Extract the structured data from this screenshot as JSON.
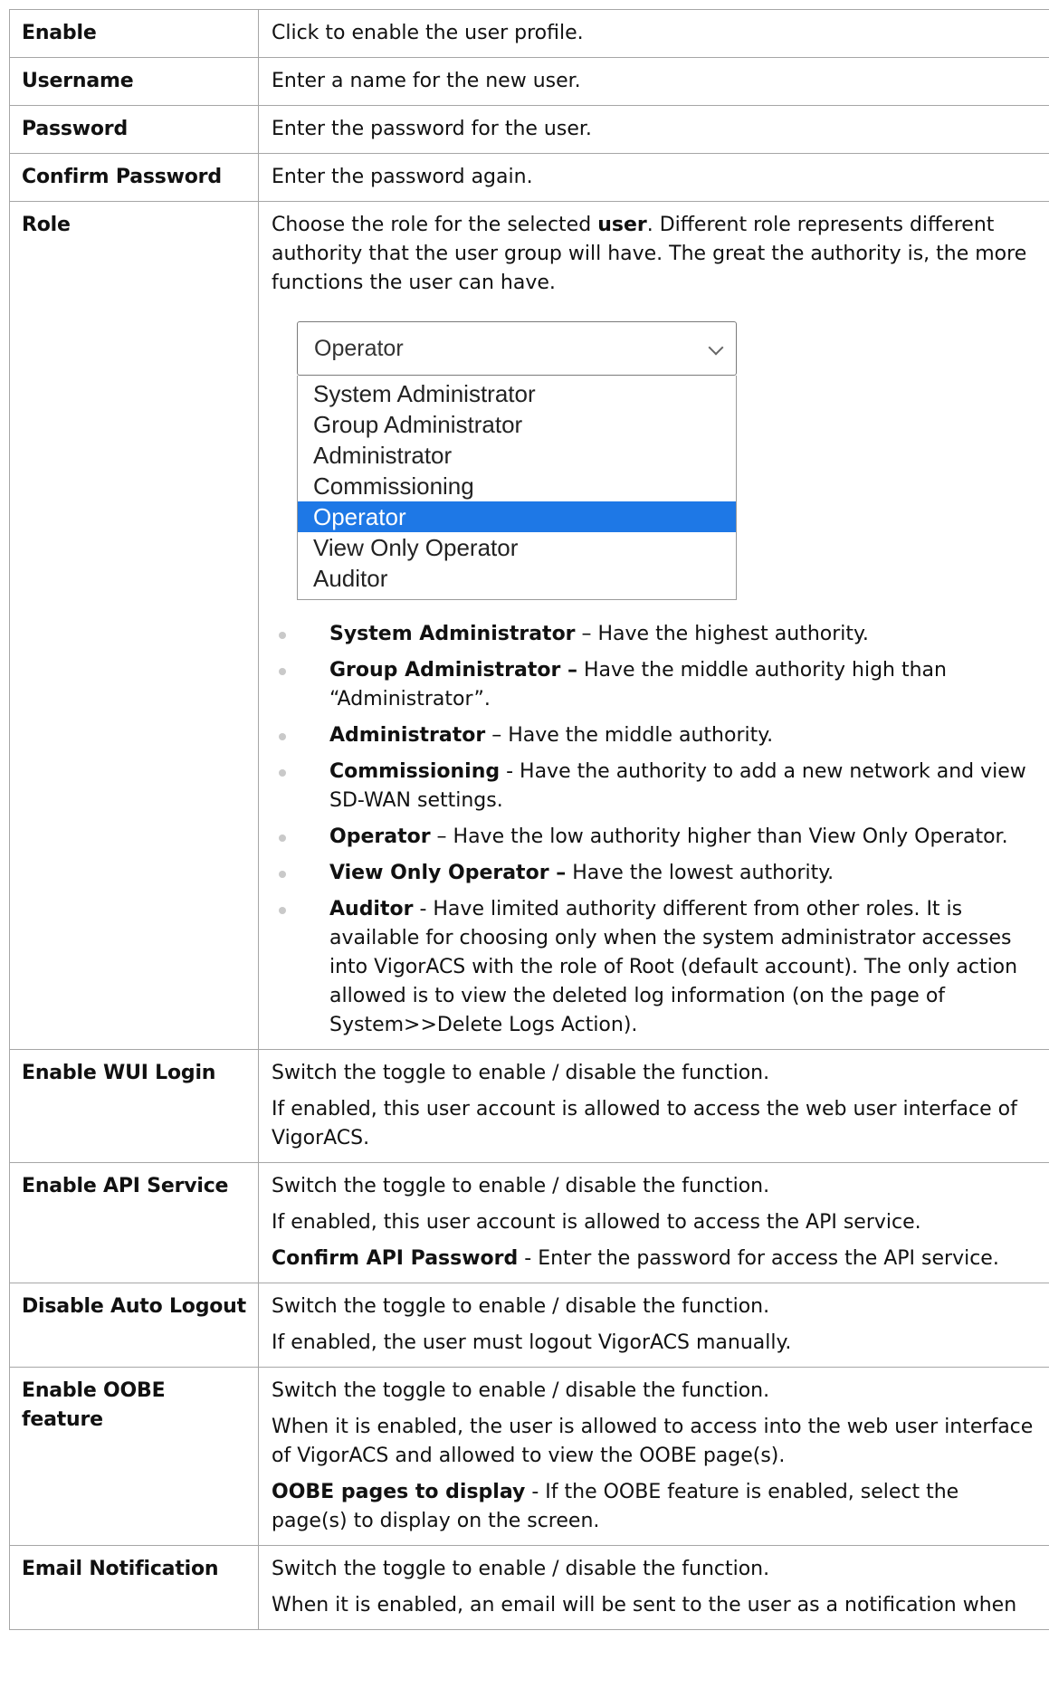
{
  "rows": [
    {
      "label": "Enable",
      "desc": [
        "Click to enable the user profile."
      ]
    },
    {
      "label": "Username",
      "desc": [
        "Enter a name for the new user."
      ]
    },
    {
      "label": "Password",
      "desc": [
        "Enter the password for the user."
      ]
    },
    {
      "label": "Confirm Password",
      "desc": [
        "Enter the password again."
      ]
    },
    {
      "label": "Role",
      "intro_before": "Choose the role for the selected ",
      "intro_bold": "user",
      "intro_after": ". Different role represents different authority that the user group will have. The great the authority is, the more functions the user can have.",
      "dropdown": {
        "selected": "Operator",
        "options": [
          "System Administrator",
          "Group Administrator",
          "Administrator",
          "Commissioning",
          "Operator",
          "View Only Operator",
          "Auditor"
        ],
        "highlighted_index": 4,
        "highlight_color": "#1e78e6"
      },
      "bullets": [
        {
          "term": "System Administrator",
          "text": " – Have the highest authority."
        },
        {
          "term": "Group Administrator –",
          "text": " Have the middle authority high than “Administrator”."
        },
        {
          "term": "Administrator",
          "text": " – Have the middle authority."
        },
        {
          "term": "Commissioning",
          "text": " - Have the authority to add a new network and view SD-WAN settings."
        },
        {
          "term": "Operator",
          "text": " – Have the low authority higher than View Only Operator."
        },
        {
          "term": "View Only Operator –",
          "text": " Have the lowest authority."
        },
        {
          "term": "Auditor",
          "text": " - Have limited authority different from other roles. It is available for choosing only when the system administrator accesses into VigorACS with the role of Root (default account). The only action allowed is to view the deleted log information (on the page of System>>Delete Logs Action)."
        }
      ]
    },
    {
      "label": "Enable WUI Login",
      "desc": [
        "Switch the toggle to enable / disable the function.",
        "If enabled, this user account is allowed to access the web user interface of VigorACS."
      ]
    },
    {
      "label": "Enable API Service",
      "desc": [
        "Switch the toggle to enable / disable the function.",
        "If enabled, this user account is allowed to access the API service."
      ],
      "extra": {
        "term": "Confirm API Password",
        "text": " - Enter the password for access the API service."
      }
    },
    {
      "label": "Disable Auto Logout",
      "desc": [
        "Switch the toggle to enable / disable the function.",
        "If enabled, the user must logout VigorACS manually."
      ]
    },
    {
      "label": "Enable OOBE feature",
      "desc": [
        "Switch the toggle to enable / disable the function.",
        "When it is enabled, the user is allowed to access into the web user interface of VigorACS and allowed to view the OOBE page(s)."
      ],
      "extra": {
        "term": "OOBE pages to display",
        "text": " - If the OOBE feature is enabled, select the page(s) to display on the screen."
      }
    },
    {
      "label": "Email Notification",
      "desc": [
        "Switch the toggle to enable / disable the function.",
        "When it is enabled, an email will be sent to the user as a notification when"
      ]
    }
  ]
}
